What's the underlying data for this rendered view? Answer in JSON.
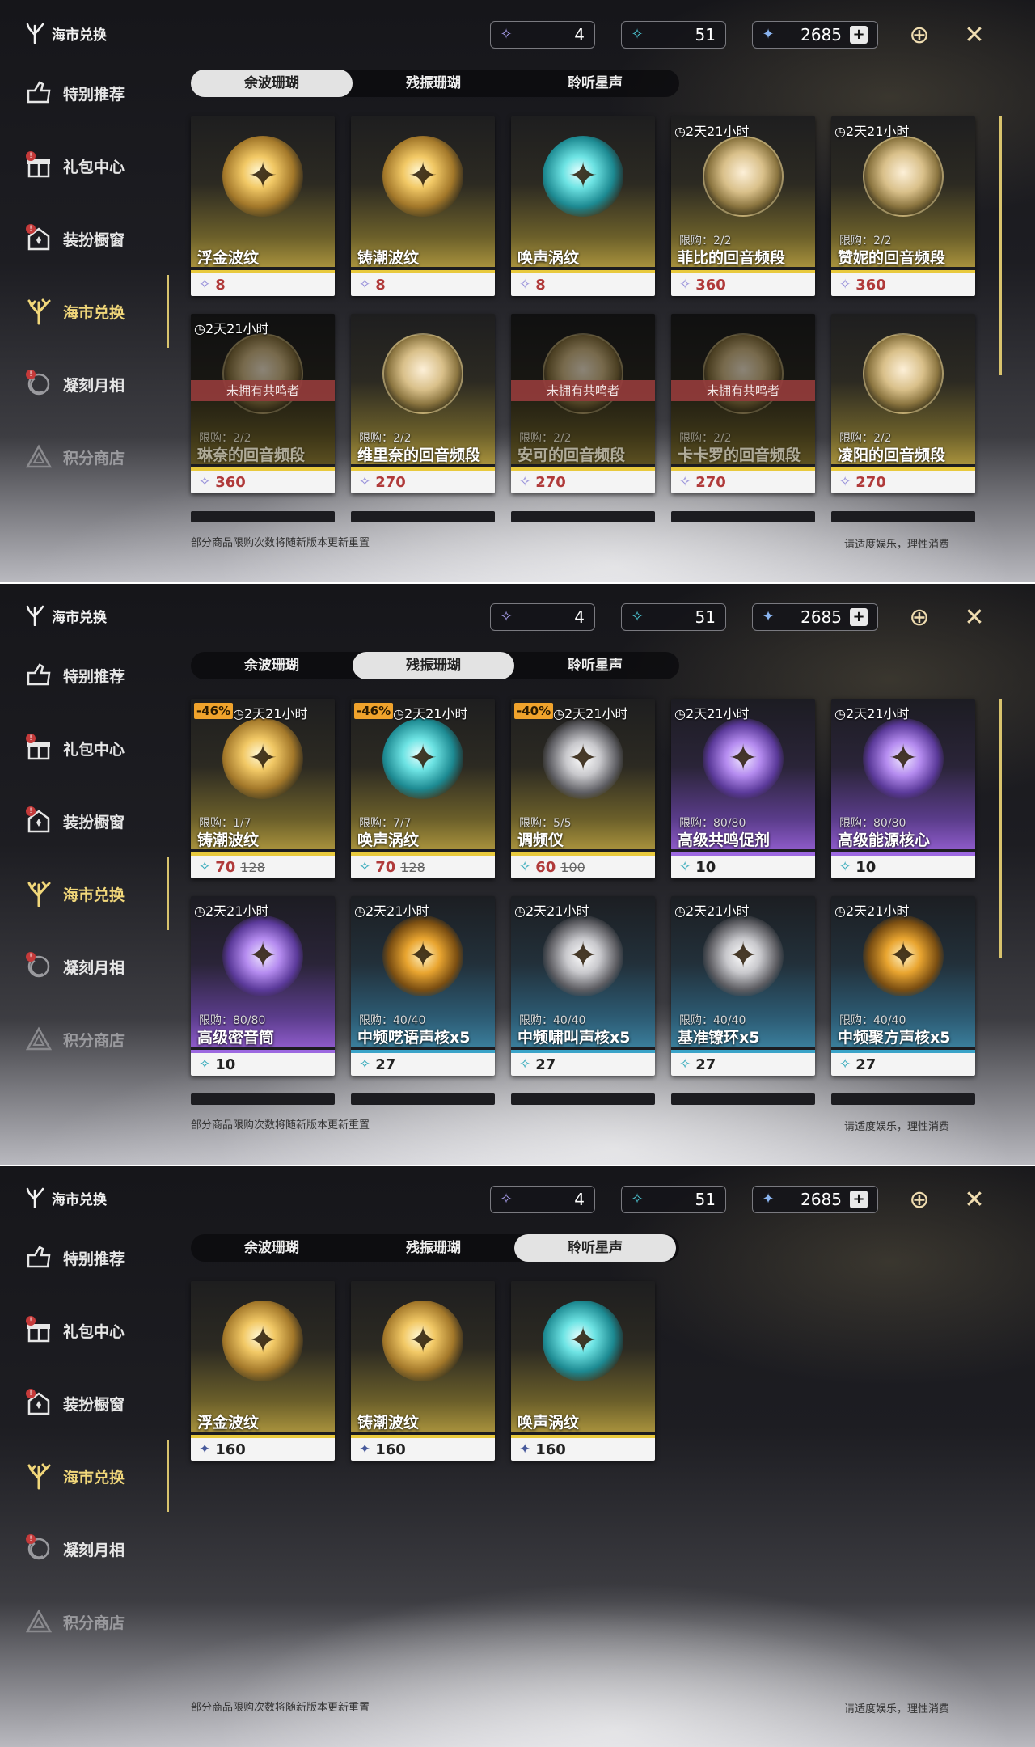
{
  "sidebar": {
    "brand": "海市兑换",
    "items": [
      {
        "label": "特别推荐",
        "icon": "recommend-icon"
      },
      {
        "label": "礼包中心",
        "icon": "gift-icon",
        "badge": "!"
      },
      {
        "label": "装扮橱窗",
        "icon": "wardrobe-icon",
        "badge": "!"
      },
      {
        "label": "海市兑换",
        "icon": "coral-icon"
      },
      {
        "label": "凝刻月相",
        "icon": "moon-icon",
        "badge": "!"
      },
      {
        "label": "积分商店",
        "icon": "triangle-icon"
      }
    ]
  },
  "currencies": [
    {
      "name": "余波珊瑚",
      "value": "4",
      "icon": "coral-purple-icon"
    },
    {
      "name": "残振珊瑚",
      "value": "51",
      "icon": "coral-teal-icon"
    },
    {
      "name": "星声",
      "value": "2685",
      "icon": "star-icon",
      "plus": "+"
    }
  ],
  "tabs": [
    "余波珊瑚",
    "残振珊瑚",
    "聆听星声"
  ],
  "footer": {
    "note": "部分商品限购次数将随新版本更新重置",
    "right": "请适度娱乐，理性消费"
  },
  "colors": {
    "accent": "#d8c36d",
    "gold": "#e8c93d",
    "purple": "#9c68e0",
    "blue": "#3aa3c8",
    "price_red": "#b03a3a"
  },
  "panels": [
    {
      "active_tab": 0,
      "cards": [
        {
          "name": "浮金波纹",
          "price": "8",
          "rarity": "gold",
          "orb": "gold",
          "price_icon": "coral1",
          "price_color": "red"
        },
        {
          "name": "铸潮波纹",
          "price": "8",
          "rarity": "gold",
          "orb": "gold",
          "price_icon": "coral1",
          "price_color": "red"
        },
        {
          "name": "唤声涡纹",
          "price": "8",
          "rarity": "gold",
          "orb": "teal",
          "price_icon": "coral1",
          "price_color": "red"
        },
        {
          "name": "菲比的回音频段",
          "price": "360",
          "timer": "2天21小时",
          "limit": "限购：2/2",
          "rarity": "gold",
          "orb": "portrait",
          "price_icon": "coral1",
          "price_color": "red"
        },
        {
          "name": "赞妮的回音频段",
          "price": "360",
          "timer": "2天21小时",
          "limit": "限购：2/2",
          "rarity": "gold",
          "orb": "portrait",
          "price_icon": "coral1",
          "price_color": "red"
        },
        {
          "name": "琳奈的回音频段",
          "price": "360",
          "timer": "2天21小时",
          "limit": "限购：2/2",
          "rarity": "gold",
          "orb": "portrait",
          "price_icon": "coral1",
          "price_color": "red",
          "locked": "未拥有共鸣者"
        },
        {
          "name": "维里奈的回音频段",
          "price": "270",
          "limit": "限购：2/2",
          "rarity": "gold",
          "orb": "portrait",
          "price_icon": "coral1",
          "price_color": "red"
        },
        {
          "name": "安可的回音频段",
          "price": "270",
          "limit": "限购：2/2",
          "rarity": "gold",
          "orb": "portrait",
          "price_icon": "coral1",
          "price_color": "red",
          "locked": "未拥有共鸣者"
        },
        {
          "name": "卡卡罗的回音频段",
          "price": "270",
          "limit": "限购：2/2",
          "rarity": "gold",
          "orb": "portrait",
          "price_icon": "coral1",
          "price_color": "red",
          "locked": "未拥有共鸣者"
        },
        {
          "name": "凌阳的回音频段",
          "price": "270",
          "limit": "限购：2/2",
          "rarity": "gold",
          "orb": "portrait",
          "price_icon": "coral1",
          "price_color": "red"
        }
      ],
      "stubs": 5
    },
    {
      "active_tab": 1,
      "cards": [
        {
          "name": "铸潮波纹",
          "price": "70",
          "old_price": "128",
          "discount": "-46%",
          "timer": "2天21小时",
          "limit": "限购：1/7",
          "rarity": "gold",
          "orb": "gold",
          "price_icon": "coral2",
          "price_color": "red"
        },
        {
          "name": "唤声涡纹",
          "price": "70",
          "old_price": "128",
          "discount": "-46%",
          "timer": "2天21小时",
          "limit": "限购：7/7",
          "rarity": "gold",
          "orb": "teal",
          "price_icon": "coral2",
          "price_color": "red"
        },
        {
          "name": "调频仪",
          "price": "60",
          "old_price": "100",
          "discount": "-40%",
          "timer": "2天21小时",
          "limit": "限购：5/5",
          "rarity": "gold",
          "orb": "metal",
          "price_icon": "coral2",
          "price_color": "red"
        },
        {
          "name": "高级共鸣促剂",
          "price": "10",
          "timer": "2天21小时",
          "limit": "限购：80/80",
          "rarity": "purple",
          "orb": "purple",
          "price_icon": "coral2",
          "price_color": "dark"
        },
        {
          "name": "高级能源核心",
          "price": "10",
          "timer": "2天21小时",
          "limit": "限购：80/80",
          "rarity": "purple",
          "orb": "purple",
          "price_icon": "coral2",
          "price_color": "dark"
        },
        {
          "name": "高级密音筒",
          "price": "10",
          "timer": "2天21小时",
          "limit": "限购：80/80",
          "rarity": "purple",
          "orb": "purple",
          "price_icon": "coral2",
          "price_color": "dark"
        },
        {
          "name": "中频呓语声核x5",
          "price": "27",
          "timer": "2天21小时",
          "limit": "限购：40/40",
          "rarity": "blue",
          "orb": "amber",
          "price_icon": "coral2",
          "price_color": "dark"
        },
        {
          "name": "中频啸叫声核x5",
          "price": "27",
          "timer": "2天21小时",
          "limit": "限购：40/40",
          "rarity": "blue",
          "orb": "metal",
          "price_icon": "coral2",
          "price_color": "dark"
        },
        {
          "name": "基准镣环x5",
          "price": "27",
          "timer": "2天21小时",
          "limit": "限购：40/40",
          "rarity": "blue",
          "orb": "metal",
          "price_icon": "coral2",
          "price_color": "dark"
        },
        {
          "name": "中频聚方声核x5",
          "price": "27",
          "timer": "2天21小时",
          "limit": "限购：40/40",
          "rarity": "blue",
          "orb": "amber",
          "price_icon": "coral2",
          "price_color": "dark"
        }
      ],
      "stubs": 5
    },
    {
      "active_tab": 2,
      "cards": [
        {
          "name": "浮金波纹",
          "price": "160",
          "rarity": "gold",
          "orb": "gold",
          "price_icon": "star",
          "price_color": "dark"
        },
        {
          "name": "铸潮波纹",
          "price": "160",
          "rarity": "gold",
          "orb": "gold",
          "price_icon": "star",
          "price_color": "dark"
        },
        {
          "name": "唤声涡纹",
          "price": "160",
          "rarity": "gold",
          "orb": "teal",
          "price_icon": "star",
          "price_color": "dark"
        }
      ],
      "stubs": 0
    }
  ]
}
